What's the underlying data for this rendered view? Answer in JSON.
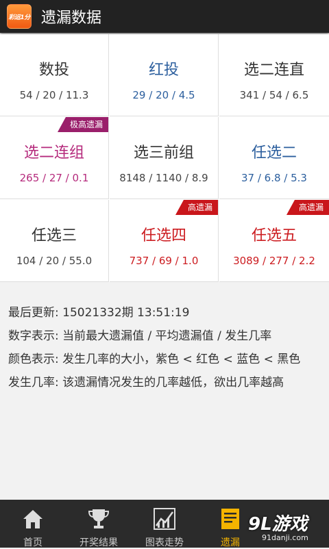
{
  "header": {
    "title": "遗漏数据",
    "app_logo_text": "彩运1分"
  },
  "grid": [
    {
      "name": "数投",
      "nums": "54 / 20 / 11.3",
      "color": "black",
      "badge": ""
    },
    {
      "name": "红投",
      "nums": "29 / 20 / 4.5",
      "color": "blue",
      "badge": ""
    },
    {
      "name": "选二连直",
      "nums": "341 / 54 / 6.5",
      "color": "black",
      "badge": ""
    },
    {
      "name": "选二连组",
      "nums": "265 / 27 / 0.1",
      "color": "purple",
      "badge": "极高遗漏"
    },
    {
      "name": "选三前组",
      "nums": "8148 / 1140 / 8.9",
      "color": "black",
      "badge": ""
    },
    {
      "name": "任选二",
      "nums": "37 / 6.8 / 5.3",
      "color": "blue",
      "badge": ""
    },
    {
      "name": "任选三",
      "nums": "104 / 20 / 55.0",
      "color": "black",
      "badge": ""
    },
    {
      "name": "任选四",
      "nums": "737 / 69 / 1.0",
      "color": "red",
      "badge": "高遗漏"
    },
    {
      "name": "任选五",
      "nums": "3089 / 277 / 2.2",
      "color": "red",
      "badge": "高遗漏"
    }
  ],
  "info": {
    "updated": "最后更新: 15021332期  13:51:19",
    "digits": "数字表示: 当前最大遗漏值 / 平均遗漏值 / 发生几率",
    "colors": "颜色表示: 发生几率的大小，紫色 < 红色 < 蓝色 < 黑色",
    "probability": "发生几率: 该遗漏情况发生的几率越低，欲出几率越高"
  },
  "tabs": [
    {
      "label": "首页",
      "icon": "home-icon"
    },
    {
      "label": "开奖结果",
      "icon": "trophy-icon"
    },
    {
      "label": "图表走势",
      "icon": "chart-icon"
    },
    {
      "label": "遗漏",
      "icon": "document-icon",
      "active": true
    }
  ],
  "watermark": {
    "main": "9L游戏",
    "sub": "91danji.com"
  },
  "colors": {
    "black": "#333333",
    "blue": "#2c5f9e",
    "purple": "#b52a7c",
    "red": "#cc1c20",
    "accent": "#f5b400"
  }
}
